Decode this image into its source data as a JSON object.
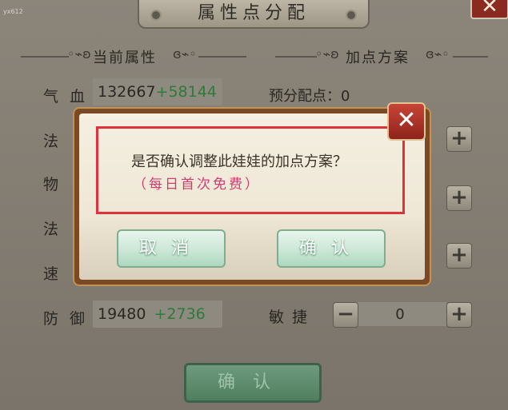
{
  "watermark": "yx612",
  "title": "属性点分配",
  "close_glyph": "✕",
  "left_section": {
    "title": "当前属性"
  },
  "right_section": {
    "title": "加点方案"
  },
  "curl_left": "◦⌁ʚ",
  "curl_right": "ɞ⌁◦",
  "attributes": [
    {
      "label": "气血",
      "base": "132667",
      "bonus": "+58144"
    },
    {
      "label": "法",
      "base": "",
      "bonus": ""
    },
    {
      "label": "物",
      "base": "",
      "bonus": ""
    },
    {
      "label": "法",
      "base": "",
      "bonus": ""
    },
    {
      "label": "速",
      "base": "",
      "bonus": ""
    },
    {
      "label": "防御",
      "base": "19480",
      "bonus": "+2736"
    }
  ],
  "pre_points": "预分配点：0",
  "agility": {
    "label": "敏捷",
    "value": "0",
    "minus": "−",
    "plus": "+"
  },
  "plus_glyph": "+",
  "confirm_label": "确认",
  "dialog": {
    "question": "是否确认调整此娃娃的加点方案？",
    "note": "（每日首次免费）",
    "cancel": "取消",
    "ok": "确认",
    "close": "✕"
  },
  "colors": {
    "bonus_green": "#2e7a3a",
    "note_pink": "#d23b71",
    "highlight_red": "#e0323a"
  }
}
